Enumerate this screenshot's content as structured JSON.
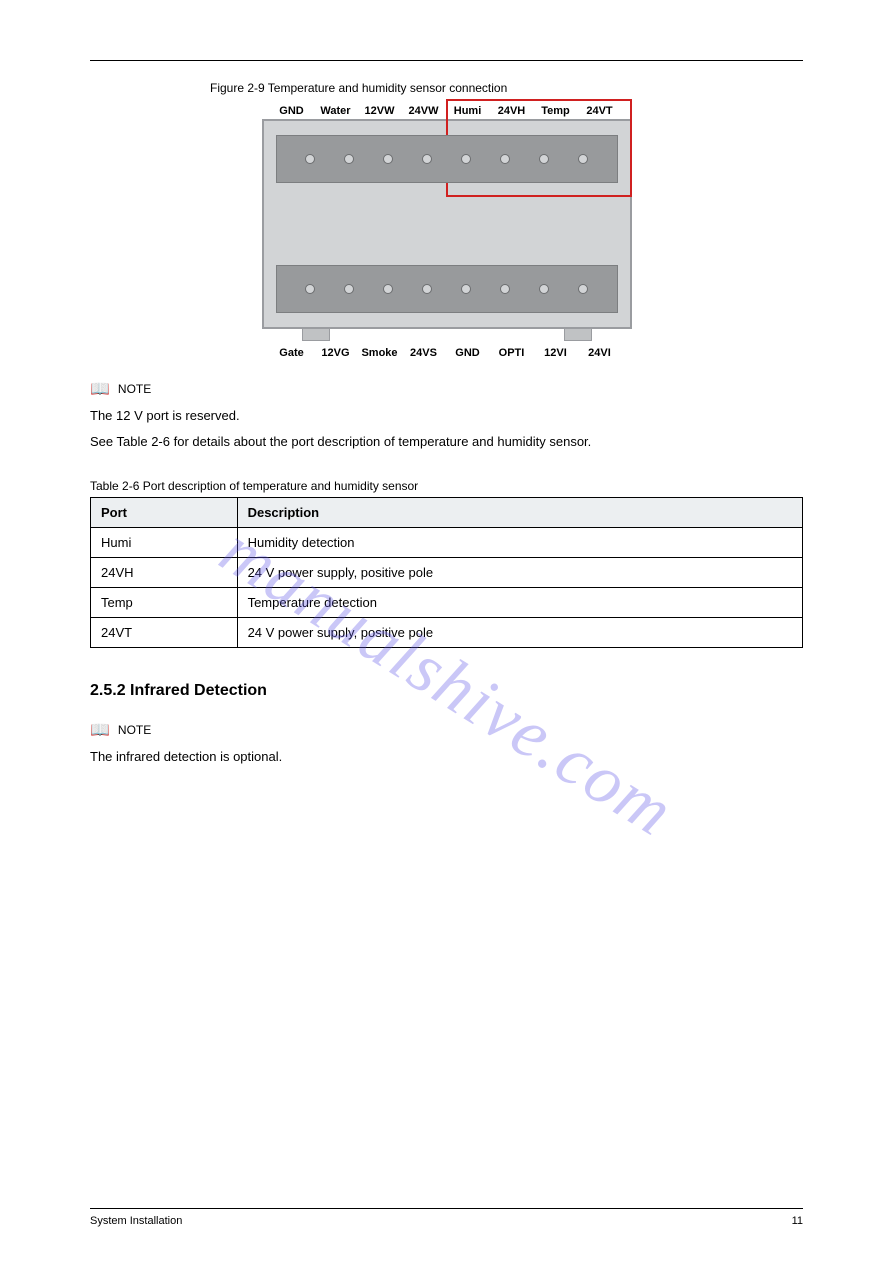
{
  "figure": {
    "caption": "Figure 2-9 Temperature and humidity sensor connection",
    "top_labels": [
      "GND",
      "Water",
      "12VW",
      "24VW",
      "Humi",
      "24VH",
      "Temp",
      "24VT"
    ],
    "bottom_labels": [
      "Gate",
      "12VG",
      "Smoke",
      "24VS",
      "GND",
      "OPTI",
      "12VI",
      "24VI"
    ]
  },
  "note1": {
    "icon": "📖",
    "label": "NOTE",
    "text": "The 12 V port is reserved."
  },
  "para1": "See Table 2-6 for details about the port description of temperature and humidity sensor.",
  "table": {
    "caption": "Table 2-6 Port description of temperature and humidity sensor",
    "headers": [
      "Port",
      "Description"
    ],
    "rows": [
      [
        "Humi",
        "Humidity detection"
      ],
      [
        "24VH",
        "24 V power supply, positive pole"
      ],
      [
        "Temp",
        "Temperature detection"
      ],
      [
        "24VT",
        "24 V power supply, positive pole"
      ]
    ]
  },
  "section": {
    "number": "2.5.2 Infrared Detection",
    "note_icon": "📖",
    "note_label": "NOTE",
    "note_text": "The infrared detection is optional."
  },
  "watermark": "manualshive.com",
  "footer": {
    "left": "System Installation",
    "right": "11"
  }
}
